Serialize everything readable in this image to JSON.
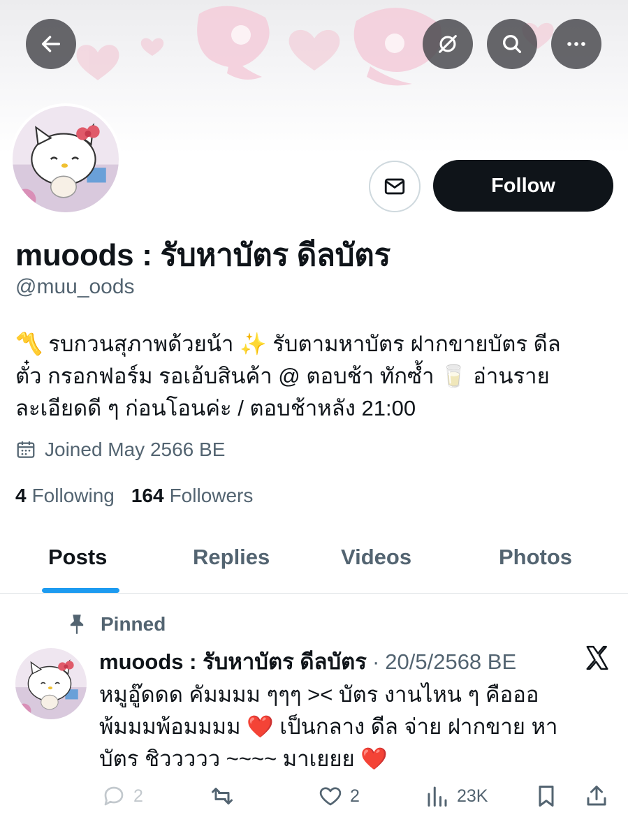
{
  "header": {
    "back_icon": "arrow-left-icon",
    "grok_icon": "grok-icon",
    "search_icon": "search-icon",
    "more_icon": "more-dots-icon"
  },
  "profile": {
    "display_name": "muoods : รับหาบัตร ดีลบัตร",
    "handle": "@muu_oods",
    "follow_label": "Follow",
    "bio_lines": [
      "〽️ รบกวนสุภาพด้วยน้า ✨ รับตามหาบัตร ฝากขายบัตร ดีล",
      "ตั๋ว กรอกฟอร์ม รอเอ้บสินค้า @ ตอบช้า ทักซ้ำ 🥛 อ่านราย",
      "ละเอียดดี ๆ ก่อนโอนค่ะ / ตอบช้าหลัง 21:00"
    ],
    "joined": "Joined May 2566 BE",
    "following_count": "4",
    "following_label": "Following",
    "followers_count": "164",
    "followers_label": "Followers"
  },
  "tabs": [
    {
      "label": "Posts",
      "active": true
    },
    {
      "label": "Replies",
      "active": false
    },
    {
      "label": "Videos",
      "active": false
    },
    {
      "label": "Photos",
      "active": false
    }
  ],
  "post": {
    "pinned_label": "Pinned",
    "author": "muoods : รับหาบัตร ดีลบัตร",
    "separator": "·",
    "date": "20/5/2568 BE",
    "text_lines": [
      "หมูอู๊ดดด คัมมมม ๆๆๆ ><  บัตร งานไหน ๆ คือออ",
      "พ้มมมพ้อมมมม",
      "เป็นกลาง ดีล จ่าย ฝากขาย หา",
      "บัตร ชิววววว ~~~~ มาเยยย"
    ],
    "heart_glyph": "❤️",
    "replies": "2",
    "likes": "2",
    "views": "23K"
  },
  "colors": {
    "accent": "#1d9bf0",
    "text_primary": "#0f1419",
    "text_secondary": "#536471",
    "follow_bg": "#0f1419"
  }
}
